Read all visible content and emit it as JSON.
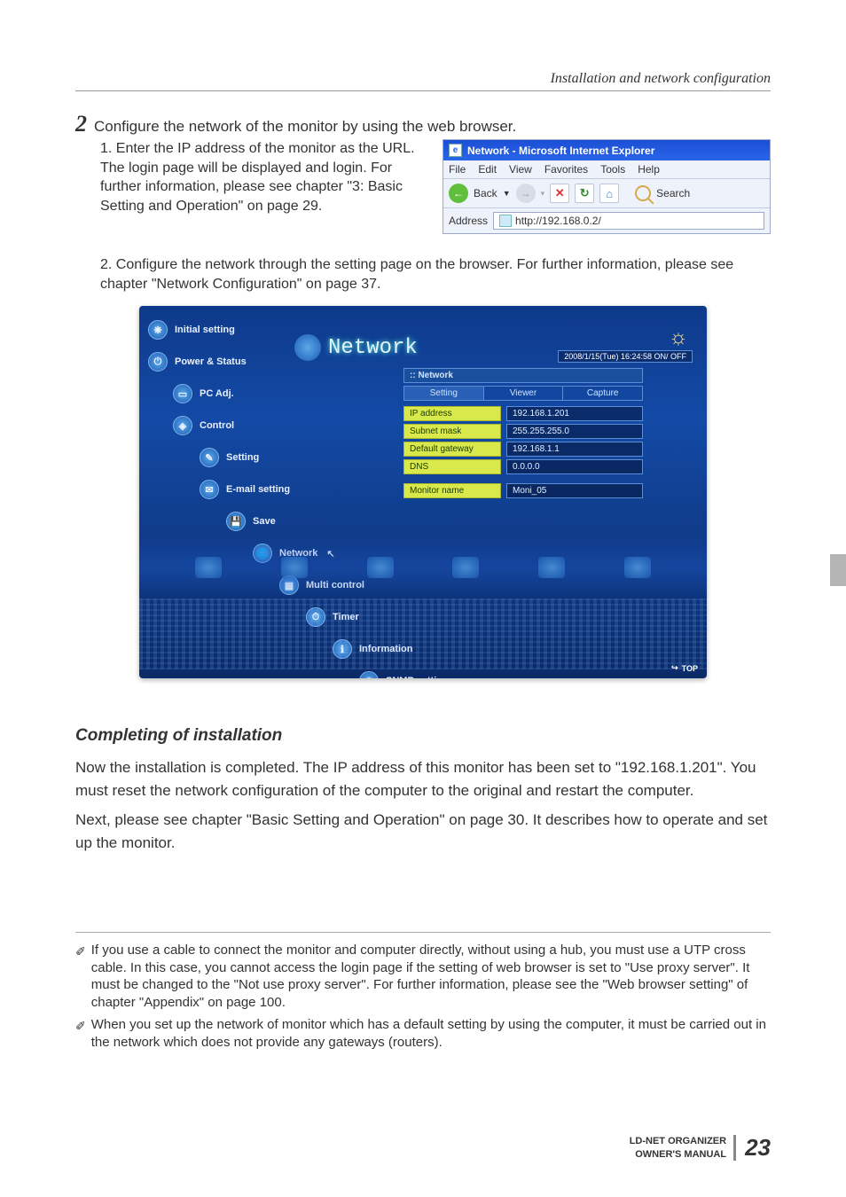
{
  "header": {
    "running": "Installation and network configuration"
  },
  "step": {
    "num": "2",
    "text": "Configure the network of the monitor by using the web browser."
  },
  "sub1": {
    "lead": "1. Enter the IP address of the monitor as the URL. The login page will be displayed and login. For further information, please see chapter \"3: Basic Setting and Operation\" on page 29."
  },
  "browser": {
    "title": "Network - Microsoft Internet Explorer",
    "menu": {
      "file": "File",
      "edit": "Edit",
      "view": "View",
      "favorites": "Favorites",
      "tools": "Tools",
      "help": "Help"
    },
    "tool": {
      "back": "Back",
      "search": "Search"
    },
    "address_label": "Address",
    "url": "http://192.168.0.2/"
  },
  "sub2": {
    "text": "2. Configure the network through the setting page on the browser. For further information, please see chapter \"Network Configuration\" on page 37."
  },
  "panel": {
    "title": "Network",
    "status": "2008/1/15(Tue)    16:24:58  ON/ OFF",
    "section": ":: Network",
    "tabs": {
      "setting": "Setting",
      "viewer": "Viewer",
      "capture": "Capture"
    },
    "fields": {
      "ip_label": "IP address",
      "ip_val": "192.168.1.201",
      "mask_label": "Subnet mask",
      "mask_val": "255.255.255.0",
      "gw_label": "Default gateway",
      "gw_val": "192.168.1.1",
      "dns_label": "DNS",
      "dns_val": "0.0.0.0",
      "name_label": "Monitor name",
      "name_val": "Moni_05"
    },
    "nav": {
      "initial": "Initial setting",
      "power": "Power & Status",
      "pcadj": "PC Adj.",
      "control": "Control",
      "setting": "Setting",
      "email": "E-mail setting",
      "save": "Save",
      "network": "Network",
      "multi": "Multi control",
      "timer": "Timer",
      "info": "Information",
      "snmp": "SNMP setting"
    },
    "top_link": "TOP"
  },
  "completing": {
    "heading": "Completing of installation",
    "p1": "Now the installation is completed. The IP address of this monitor has been set to \"192.168.1.201\". You must reset the network configuration of the computer to the original and restart the computer.",
    "p2": "Next, please see chapter \"Basic Setting and Operation\" on page 30. It describes how to operate and set up the monitor."
  },
  "notes": {
    "n1": "If you use a cable to connect the monitor and computer directly, without using a hub, you must use a UTP cross cable. In this case, you cannot access the login page if the setting of web browser is set to \"Use proxy server\". It must be changed to the \"Not use proxy server\". For further information, please see the \"Web browser setting\" of chapter \"Appendix\" on page 100.",
    "n2": "When you set up the network of monitor which has a default setting by using the computer, it must  be carried out in the network which does not provide any gateways (routers)."
  },
  "footer": {
    "line1": "LD-NET ORGANIZER",
    "line2": "OWNER'S MANUAL",
    "page": "23"
  }
}
